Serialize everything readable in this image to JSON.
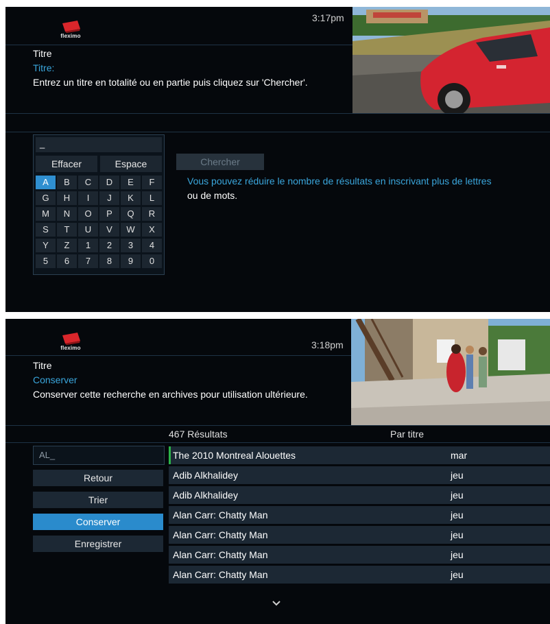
{
  "screen1": {
    "brand": "fleximo",
    "clock": "3:17pm",
    "title": "Titre",
    "field_label": "Titre:",
    "instruction": "Entrez un titre en totalité ou en partie puis cliquez sur 'Chercher'.",
    "keyboard": {
      "input_value": "_",
      "clear_label": "Effacer",
      "space_label": "Espace",
      "selected_key": "A",
      "rows": [
        [
          "A",
          "B",
          "C",
          "D",
          "E",
          "F"
        ],
        [
          "G",
          "H",
          "I",
          "J",
          "K",
          "L"
        ],
        [
          "M",
          "N",
          "O",
          "P",
          "Q",
          "R"
        ],
        [
          "S",
          "T",
          "U",
          "V",
          "W",
          "X"
        ],
        [
          "Y",
          "Z",
          "1",
          "2",
          "3",
          "4"
        ],
        [
          "5",
          "6",
          "7",
          "8",
          "9",
          "0"
        ]
      ]
    },
    "search_button": "Chercher",
    "hint_line1": "Vous pouvez réduire le nombre de résultats en inscrivant plus de lettres",
    "hint_line2": "ou de mots."
  },
  "screen2": {
    "brand": "fleximo",
    "clock": "3:18pm",
    "title": "Titre",
    "selected_option": "Conserver",
    "description": "Conserver cette recherche en archives pour utilisation ultérieure.",
    "results_count": "467 Résultats",
    "sort_label": "Par titre",
    "search_value": "AL_",
    "buttons": [
      "Retour",
      "Trier",
      "Conserver",
      "Enregistrer"
    ],
    "active_button": "Conserver",
    "results": [
      {
        "title": "The 2010 Montreal Alouettes",
        "day": "mar"
      },
      {
        "title": "Adib Alkhalidey",
        "day": "jeu"
      },
      {
        "title": "Adib Alkhalidey",
        "day": "jeu"
      },
      {
        "title": "Alan Carr: Chatty Man",
        "day": "jeu"
      },
      {
        "title": "Alan Carr: Chatty Man",
        "day": "jeu"
      },
      {
        "title": "Alan Carr: Chatty Man",
        "day": "jeu"
      },
      {
        "title": "Alan Carr: Chatty Man",
        "day": "jeu"
      }
    ],
    "scroll_icon": "chevron-down-icon"
  },
  "colors": {
    "accent_blue": "#2a8bcc",
    "hint_blue": "#3aa6dc",
    "background": "#05080c",
    "row_bg": "#1c2834",
    "focus_marker": "#2cb34a"
  }
}
